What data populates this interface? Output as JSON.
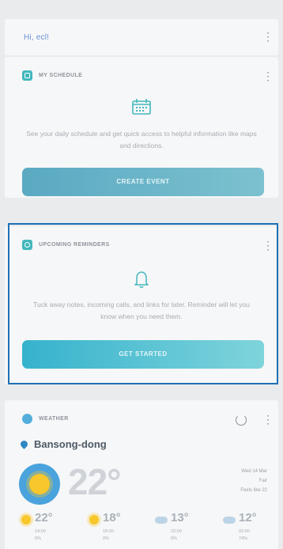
{
  "header": {
    "greeting": "Hi, ecl!"
  },
  "schedule": {
    "title": "MY SCHEDULE",
    "description": "See your daily schedule and get quick access to helpful information like maps and directions.",
    "button": "CREATE EVENT",
    "icon": "calendar-icon"
  },
  "reminders": {
    "title": "UPCOMING REMINDERS",
    "description": "Tuck away notes, incoming calls, and links for later. Reminder will let you know when you need them.",
    "button": "GET STARTED",
    "icon": "bell-icon"
  },
  "weather": {
    "title": "WEATHER",
    "location": "Bansong-dong",
    "current_temp": "22°",
    "details": [
      "Wed 14 Mar",
      "Fair",
      "Feels like 22"
    ],
    "forecast": [
      {
        "icon": "sun-icon",
        "temp": "22°",
        "time": "14:00",
        "precip": "0%"
      },
      {
        "icon": "sun-icon",
        "temp": "18°",
        "time": "18:00",
        "precip": "0%"
      },
      {
        "icon": "cloud-rain-icon",
        "temp": "13°",
        "time": "22:00",
        "precip": "0%"
      },
      {
        "icon": "cloud-rain-icon",
        "temp": "12°",
        "time": "02:00",
        "precip": "74%"
      }
    ]
  },
  "colors": {
    "accent_teal": "#43b7bd",
    "highlight_border": "#1d70b5",
    "greeting_blue": "#6b8fd6"
  }
}
